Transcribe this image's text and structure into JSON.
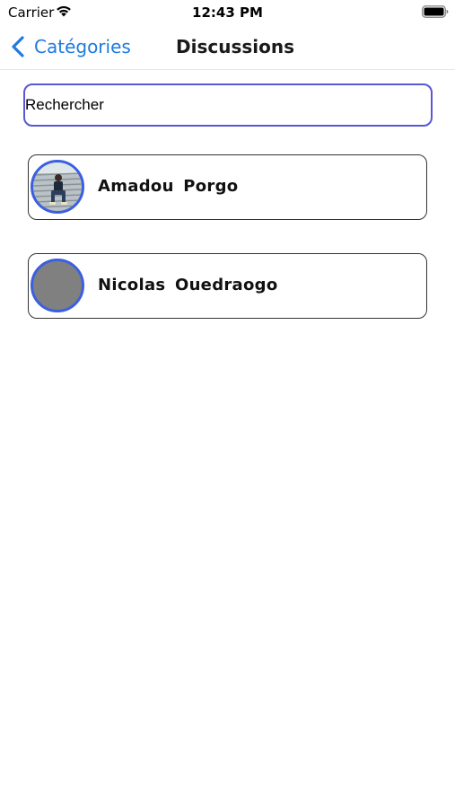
{
  "status_bar": {
    "carrier": "Carrier",
    "time": "12:43 PM",
    "wifi_icon": "wifi-icon",
    "battery_icon": "battery-icon"
  },
  "nav": {
    "back_label": "Catégories",
    "back_icon": "chevron-left-icon",
    "title": "Discussions",
    "accent_color": "#1f7ae0"
  },
  "search": {
    "placeholder": "Rechercher",
    "value": "",
    "border_color": "#5957d6"
  },
  "contacts": [
    {
      "name": "Amadou  Porgo",
      "avatar": "photo"
    },
    {
      "name": "Nicolas  Ouedraogo",
      "avatar": "placeholder-gray"
    }
  ],
  "avatar_ring_color": "#3b5fe0"
}
